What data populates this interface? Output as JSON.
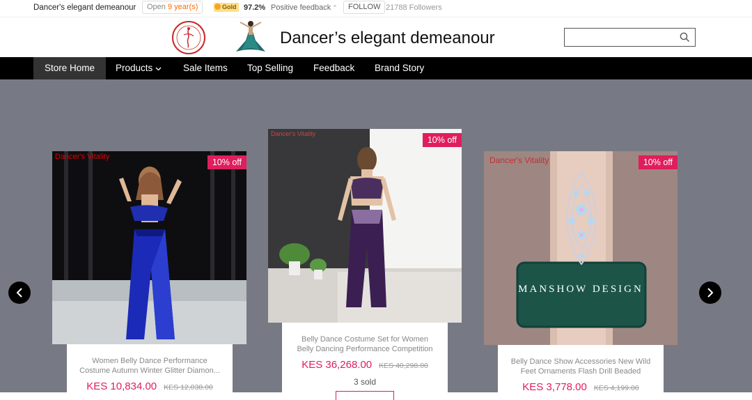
{
  "topbar": {
    "store_name": "Dancer's elegant demeanour",
    "open_prefix": "Open ",
    "open_years": "9 year(s)",
    "badge": "Gold",
    "rating": "97.2%",
    "feedback_label": "Positive feedback",
    "follow_label": "FOLLOW",
    "followers_count": "21788",
    "followers_label": " Followers"
  },
  "header": {
    "title": "Dancer’s elegant demeanour",
    "search": {
      "placeholder": "",
      "value": ""
    }
  },
  "nav": {
    "items": [
      {
        "label": "Store Home"
      },
      {
        "label": "Products"
      },
      {
        "label": "Sale Items"
      },
      {
        "label": "Top Selling"
      },
      {
        "label": "Feedback"
      },
      {
        "label": "Brand Story"
      }
    ]
  },
  "carousel": {
    "cards": [
      {
        "watermark": "Dancer's Vitality",
        "badge": "10% off",
        "name": "Women Belly Dance Performance Costume Autumn Winter Glitter Diamon...",
        "price": "KES 10,834.00",
        "old_price": "KES 12,038.00"
      },
      {
        "watermark": "Dancer's Vitality",
        "badge": "10% off",
        "name": "Belly Dance Costume Set for Women Belly Dancing Performance Competition Cloth...",
        "price": "KES 36,268.00",
        "old_price": "KES 40,298.00",
        "sold": "3 sold"
      },
      {
        "watermark": "Dancer's Vitality",
        "badge": "10% off",
        "name": "Belly Dance Show Accessories New Wild Feet Ornaments Flash Drill Beaded Legs...",
        "price": "KES 3,778.00",
        "old_price": "KES 4,199.00",
        "image_text": "MANSHOW DESIGN"
      }
    ]
  },
  "icons": [
    "medal-icon",
    "chevron-up-icon",
    "search-icon",
    "chevron-down-icon",
    "arrow-left-icon",
    "arrow-right-icon"
  ],
  "colors": {
    "accent": "#e01d5d",
    "nav_bg": "#000000",
    "stage_bg": "#777a84"
  }
}
